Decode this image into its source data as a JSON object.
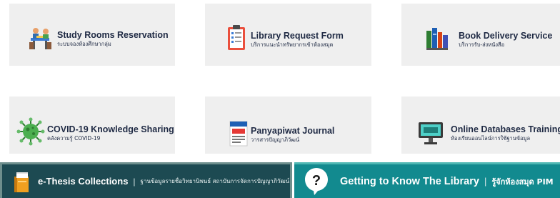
{
  "cards": [
    {
      "title": "Study Rooms Reservation",
      "subtitle": "ระบบจองห้องศึกษากลุ่ม",
      "icon": "study-room-icon"
    },
    {
      "title": "Library Request Form",
      "subtitle": "บริการแนะนำทรัพยากรเข้าห้องสมุด",
      "icon": "request-form-icon"
    },
    {
      "title": "Book Delivery Service",
      "subtitle": "บริการรับ-ส่งหนังสือ",
      "icon": "books-icon"
    },
    {
      "title": "COVID-19 Knowledge Sharing",
      "subtitle": "คลังความรู้ COVID-19",
      "icon": "virus-icon"
    },
    {
      "title": "Panyapiwat Journal",
      "subtitle": "วารสารปัญญาภิวัฒน์",
      "icon": "journal-icon"
    },
    {
      "title": "Online Databases Training",
      "subtitle": "ห้องเรียนออนไลน์การใช้ฐานข้อมูล",
      "icon": "monitor-icon"
    }
  ],
  "banners": {
    "thesis": {
      "title": "e-Thesis Collections",
      "separator": "|",
      "subtitle": "ฐานข้อมูลรายชื่อวิทยานิพนธ์ สถาบันการจัดการปัญญาภิวัฒน์",
      "icon": "book-stack-icon"
    },
    "library": {
      "title": "Getting to Know The Library",
      "separator": "|",
      "subtitle": "รู้จักห้องสมุด PIM",
      "icon": "question-icon"
    }
  },
  "colors": {
    "card_bg": "#efefef",
    "title_text": "#1f2a44",
    "thesis_bg": "#1d4a52",
    "library_bg": "#128a8f"
  }
}
